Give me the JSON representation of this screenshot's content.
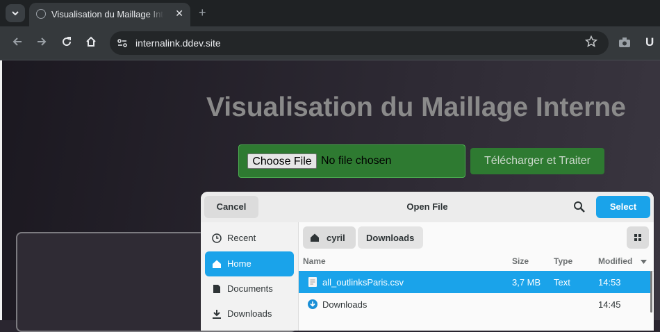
{
  "browser": {
    "tab_title": "Visualisation du Maillage Interne",
    "new_tab_glyph": "+",
    "close_glyph": "✕",
    "url": "internalink.ddev.site",
    "profile_initial": "U"
  },
  "page": {
    "title": "Visualisation du Maillage Interne",
    "choose_file_label": "Choose File",
    "no_file_text": "No file chosen",
    "upload_button": "Télécharger et Traiter",
    "accent_color": "#2e7a31"
  },
  "dialog": {
    "title": "Open File",
    "cancel": "Cancel",
    "select": "Select",
    "sidebar": [
      {
        "label": "Recent",
        "icon": "clock-icon"
      },
      {
        "label": "Home",
        "icon": "home-icon",
        "active": true
      },
      {
        "label": "Documents",
        "icon": "document-icon"
      },
      {
        "label": "Downloads",
        "icon": "download-icon"
      }
    ],
    "path": [
      "cyril",
      "Downloads"
    ],
    "columns": {
      "name": "Name",
      "size": "Size",
      "type": "Type",
      "modified": "Modified"
    },
    "rows": [
      {
        "name": "all_outlinksParis.csv",
        "size": "3,7 MB",
        "type": "Text",
        "modified": "14:53",
        "icon": "text-file-icon",
        "selected": true
      },
      {
        "name": "Downloads",
        "size": "",
        "type": "",
        "modified": "14:45",
        "icon": "download-folder-icon"
      }
    ],
    "accent_color": "#1aa3ea"
  }
}
